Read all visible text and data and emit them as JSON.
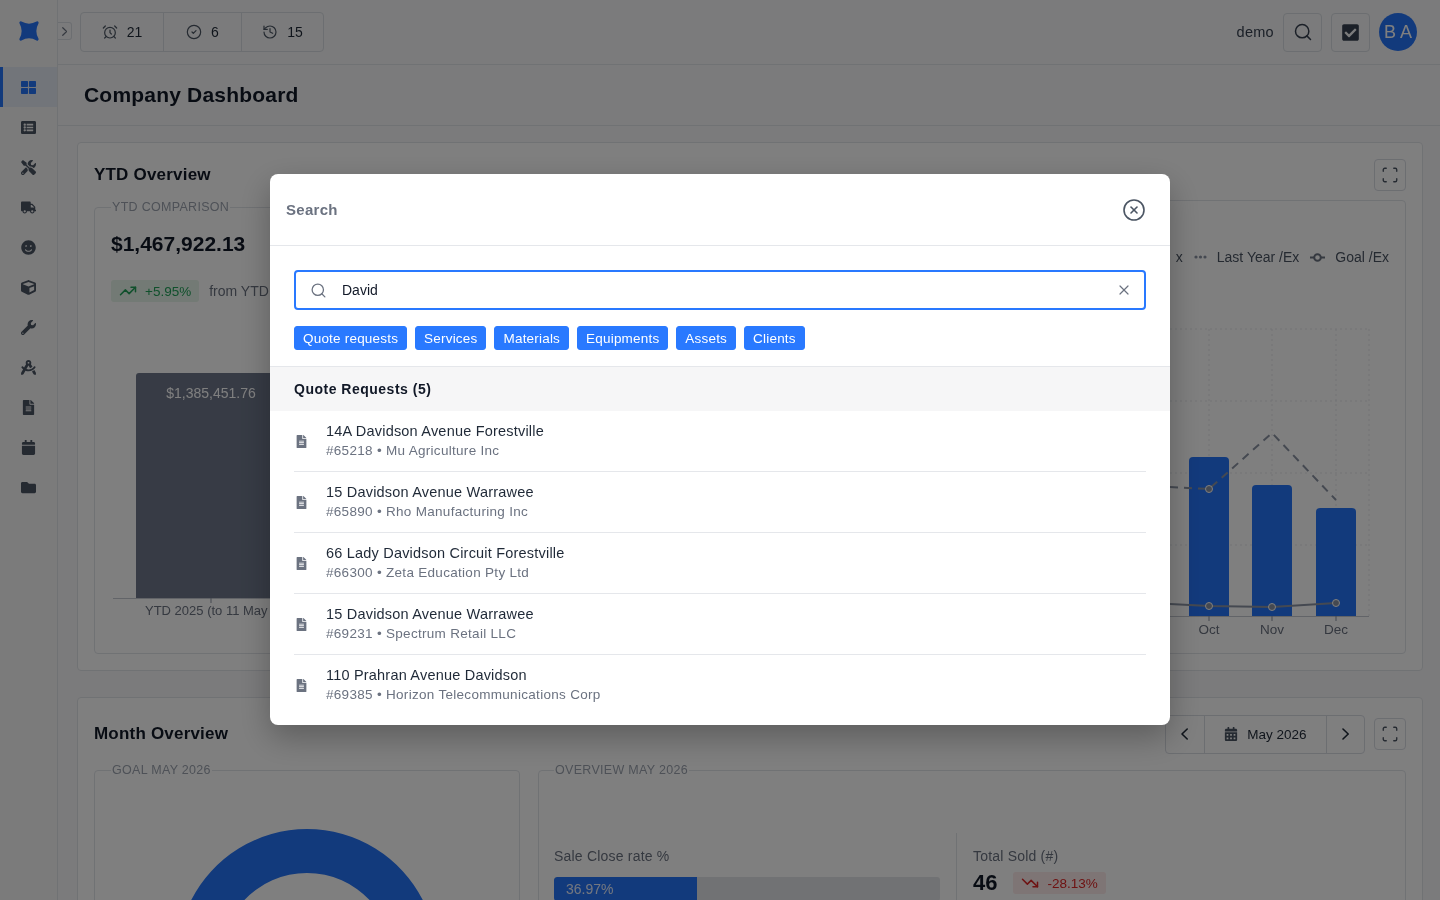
{
  "sidebar": {
    "items": [
      {
        "kind": "dashboard",
        "selected": true
      },
      {
        "kind": "list",
        "selected": false
      },
      {
        "kind": "tools",
        "selected": false
      },
      {
        "kind": "truck",
        "selected": false
      },
      {
        "kind": "smile",
        "selected": false
      },
      {
        "kind": "cube",
        "selected": false
      },
      {
        "kind": "wrench",
        "selected": false
      },
      {
        "kind": "compass",
        "selected": false
      },
      {
        "kind": "document",
        "selected": false
      },
      {
        "kind": "calendar",
        "selected": false
      },
      {
        "kind": "folder",
        "selected": false
      }
    ]
  },
  "topbar": {
    "counters": [
      {
        "kind": "alarm",
        "value": "21"
      },
      {
        "kind": "check",
        "value": "6"
      },
      {
        "kind": "history",
        "value": "15"
      }
    ],
    "user": "demo",
    "avatar": "B A"
  },
  "page": {
    "title": "Company Dashboard"
  },
  "ytd_overview": {
    "title": "YTD Overview",
    "comparison": {
      "legend": "YTD COMPARISON",
      "amount": "$1,467,922.13",
      "change": {
        "positive": true,
        "value": "+5.95%"
      },
      "change_note": "from YTD",
      "bar_label": "$1,385,451.76",
      "bar_category": "YTD 2025 (to 11 May"
    },
    "monthly_chart": {
      "legend": [
        {
          "label": "x"
        },
        {
          "kind": "dots",
          "label": "Last Year /Ex"
        },
        {
          "kind": "goal",
          "label": "Goal /Ex"
        }
      ],
      "x_labels": [
        "Oct",
        "Nov",
        "Dec"
      ]
    }
  },
  "month_overview": {
    "title": "Month Overview",
    "period": "May 2026",
    "goal": {
      "legend": "GOAL MAY 2026"
    },
    "overview": {
      "legend": "OVERVIEW MAY 2026",
      "close_rate": {
        "label": "Sale Close rate %",
        "level": 0.3697,
        "reading": "36.97%"
      },
      "total_sold": {
        "label": "Total Sold (#)",
        "value": "46",
        "change": {
          "positive": false,
          "value": "-28.13%"
        }
      }
    }
  },
  "search_modal": {
    "title": "Search",
    "query": "David",
    "filters": [
      {
        "label": "Quote requests",
        "selected": true
      },
      {
        "label": "Services",
        "selected": true
      },
      {
        "label": "Materials",
        "selected": true
      },
      {
        "label": "Equipments",
        "selected": true
      },
      {
        "label": "Assets",
        "selected": true
      },
      {
        "label": "Clients",
        "selected": true
      }
    ],
    "section": "Quote Requests (5)",
    "results": [
      {
        "title": "14A Davidson Avenue Forestville",
        "subtitle": "#65218 • Mu Agriculture Inc"
      },
      {
        "title": "15 Davidson Avenue Warrawee",
        "subtitle": "#65890 • Rho Manufacturing Inc"
      },
      {
        "title": "66 Lady Davidson Circuit Forestville",
        "subtitle": "#66300 • Zeta Education Pty Ltd"
      },
      {
        "title": "15 Davidson Avenue Warrawee",
        "subtitle": "#69231 • Spectrum Retail LLC"
      },
      {
        "title": "110 Prahran Avenue Davidson",
        "subtitle": "#69385 • Horizon Telecommunications Corp"
      }
    ]
  }
}
